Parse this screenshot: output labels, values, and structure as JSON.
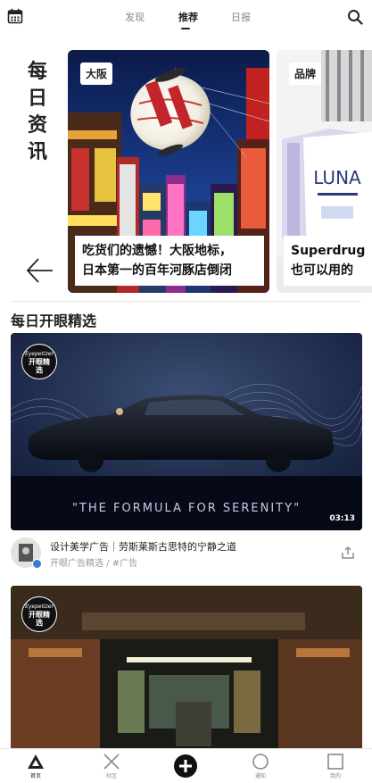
{
  "topbar": {
    "tabs": [
      {
        "label": "发现",
        "active": false
      },
      {
        "label": "推荐",
        "active": true
      },
      {
        "label": "日报",
        "active": false
      }
    ]
  },
  "daily": {
    "title": "每日资讯",
    "cards": [
      {
        "tag": "大阪",
        "caption_line1": "吃货们的遗憾！大阪地标，",
        "caption_line2": "日本第一的百年河豚店倒闭"
      },
      {
        "tag": "品牌",
        "caption_line1": "Superdrug",
        "caption_line2": "也可以用的"
      }
    ],
    "product_brand": "LUNA"
  },
  "section": {
    "title": "每日开眼精选"
  },
  "video": {
    "badge_script": "Eyepetizer",
    "badge_text": "开眼精选",
    "overlay_text": "\"THE FORMULA FOR SERENITY\"",
    "duration": "03:13",
    "title": "设计美学广告｜劳斯莱斯古思特的宁静之道",
    "subtitle": "开眼广告精选 / #广告"
  },
  "video2": {
    "badge_script": "Eyepetizer",
    "badge_text": "开眼精选"
  },
  "bottomnav": {
    "items": [
      {
        "label": "首页",
        "active": true
      },
      {
        "label": "社区",
        "active": false
      },
      {
        "label": "",
        "active": false
      },
      {
        "label": "通知",
        "active": false
      },
      {
        "label": "我的",
        "active": false
      }
    ]
  }
}
